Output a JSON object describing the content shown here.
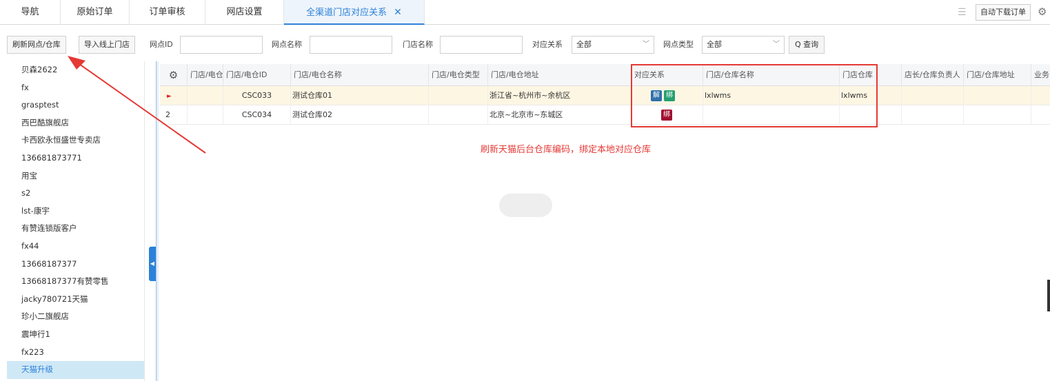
{
  "tabs": [
    {
      "label": "导航"
    },
    {
      "label": "原始订单"
    },
    {
      "label": "订单审核"
    },
    {
      "label": "网店设置"
    },
    {
      "label": "全渠道门店对应关系",
      "close": "✕"
    }
  ],
  "tabbar_right": {
    "menu_icon": "☰",
    "auto_label": "自动下载订单",
    "gear": "⚙"
  },
  "toolbar": {
    "refresh_label": "刷新网点/仓库",
    "import_label": "导入线上门店",
    "outlet_id_label": "网点ID",
    "outlet_name_label": "网点名称",
    "store_name_label": "门店名称",
    "relation_label": "对应关系",
    "relation_value": "全部",
    "type_label": "网点类型",
    "type_value": "全部",
    "query_label": "Q 查询"
  },
  "left_list": [
    "贝森2622",
    "fx",
    "grasptest",
    "西巴酷旗舰店",
    "卡西欧永恒盛世专卖店",
    "136681873771",
    "用宝",
    "s2",
    "lst-康宇",
    "有赞连锁版客户",
    "fx44",
    "13668187377",
    "13668187377有赞零售",
    "jacky780721天猫",
    "珍小二旗舰店",
    "震坤行1",
    "fx223",
    "天猫升级"
  ],
  "grid": {
    "gear": "⚙",
    "headers": [
      "门店/电仓",
      "门店/电仓ID",
      "门店/电仓名称",
      "门店/电仓类型",
      "门店/电仓地址",
      "对应关系",
      "门店/仓库名称",
      "门店仓库",
      "店长/仓库负责人",
      "门店/仓库地址",
      "业务"
    ],
    "rows": [
      {
        "marker": "►",
        "id": "CSC033",
        "name": "测试仓库01",
        "type": "",
        "address": "浙江省~杭州市~余杭区",
        "tags": [
          "解",
          "绑"
        ],
        "store_name": "lxlwms",
        "store_wh": "lxlwms"
      },
      {
        "marker": "2",
        "id": "CSC034",
        "name": "测试仓库02",
        "type": "",
        "address": "北京~北京市~东城区",
        "tags": [
          "绑"
        ],
        "store_name": "",
        "store_wh": ""
      }
    ]
  },
  "annotation": "刷新天猫后台仓库编码，绑定本地对应仓库",
  "colors": {
    "accent": "#2c82d8",
    "annotation": "#e53935",
    "unbind": "#2f6faa",
    "bind": "#23a06f",
    "bind_alt": "#a01030"
  }
}
